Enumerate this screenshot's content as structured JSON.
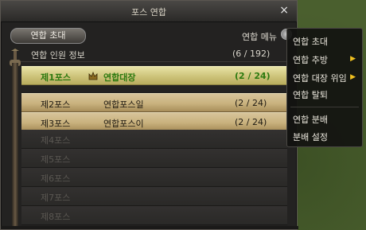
{
  "window": {
    "title": "포스 연합",
    "close_glyph": "×"
  },
  "toolbar": {
    "invite_label": "연합 초대",
    "menu_label": "연합 메뉴"
  },
  "info": {
    "label": "연합 인원 정보",
    "count": "(6 / 192)"
  },
  "rows": [
    {
      "pos": "제1포스",
      "name": "연합대장",
      "count": "(2 / 24)"
    },
    {
      "pos": "제2포스",
      "name": "연합포스일",
      "count": "(2 / 24)"
    },
    {
      "pos": "제3포스",
      "name": "연합포스이",
      "count": "(2 / 24)"
    },
    {
      "pos": "제4포스"
    },
    {
      "pos": "제5포스"
    },
    {
      "pos": "제6포스"
    },
    {
      "pos": "제7포스"
    },
    {
      "pos": "제8포스"
    }
  ],
  "context_menu": {
    "items": [
      {
        "label": "연합 초대"
      },
      {
        "label": "연합 추방",
        "submenu_glyph": "▶"
      },
      {
        "label": "연합 대장 위임",
        "submenu_glyph": "▶"
      },
      {
        "label": "연합 탈퇴"
      },
      {
        "label": "연합 분배"
      },
      {
        "label": "분배 설정"
      }
    ]
  },
  "colors": {
    "active_row_text": "#2d7a10",
    "submenu_arrow": "#f0c020"
  }
}
